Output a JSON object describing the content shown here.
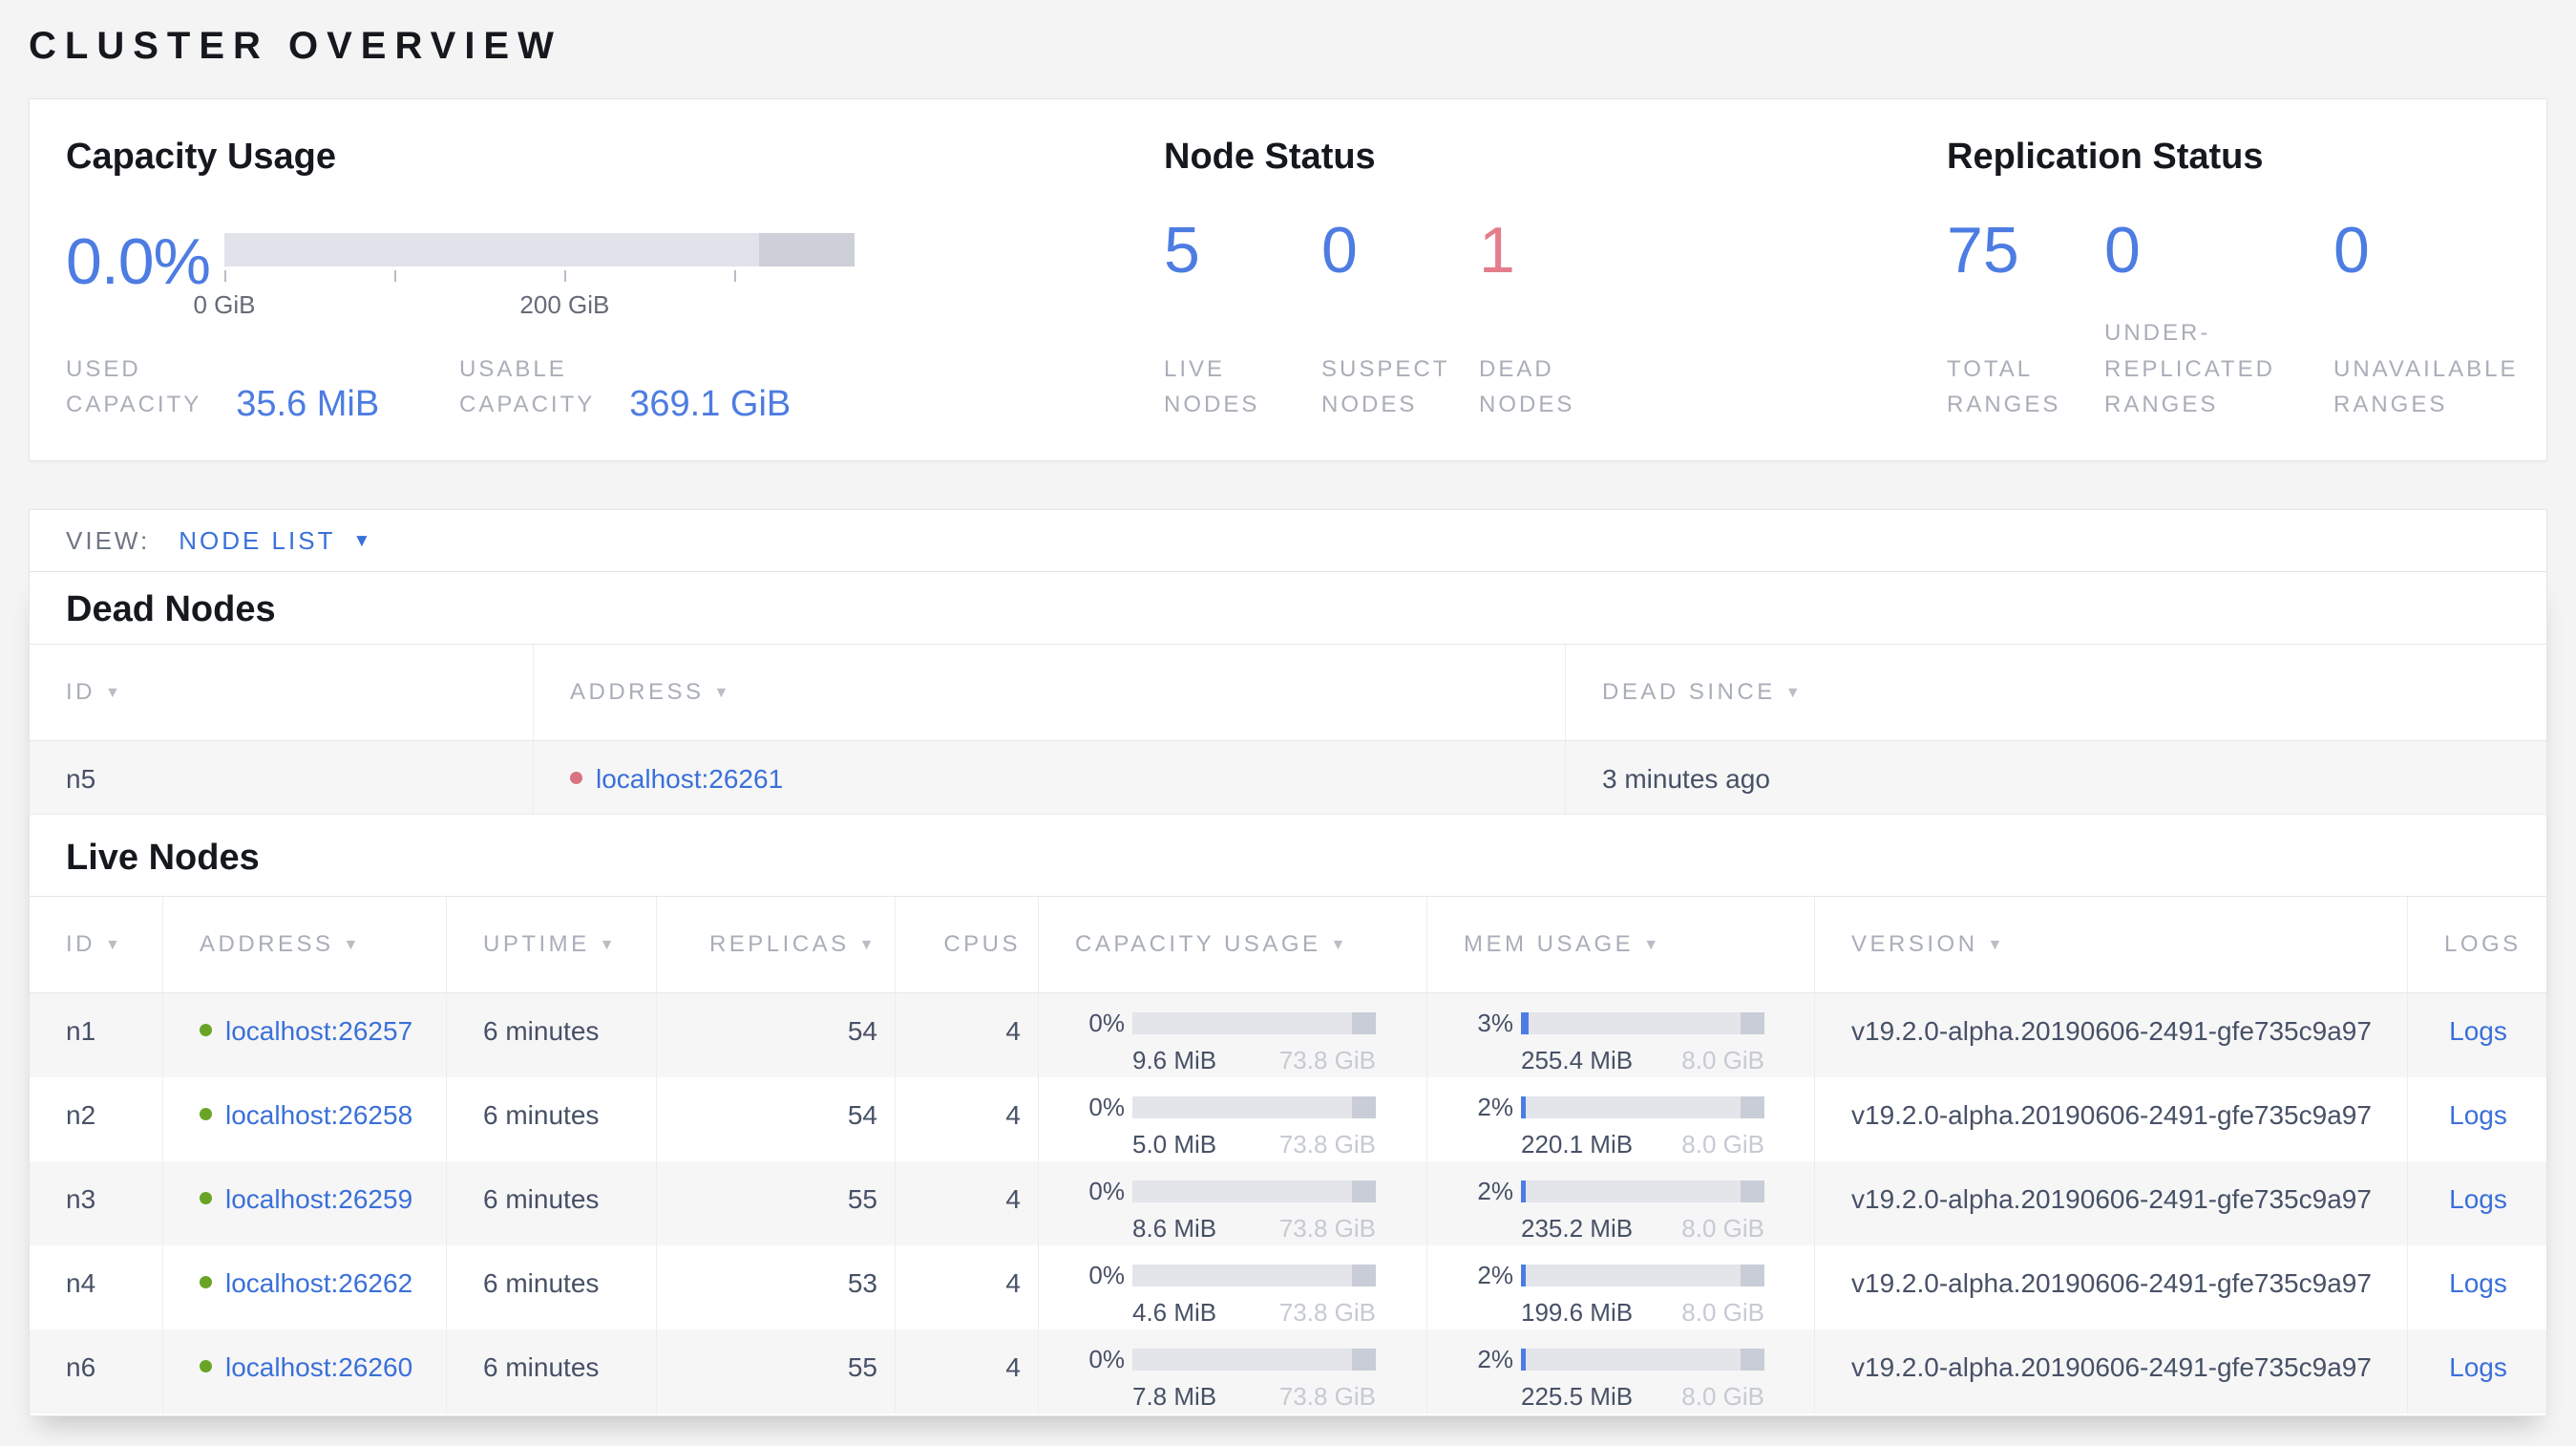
{
  "page": {
    "title": "CLUSTER OVERVIEW"
  },
  "colors": {
    "accent-blue": "#4d7ce2",
    "link-blue": "#3a70d9",
    "danger-red": "#e37d8c",
    "live-green": "#69a426",
    "dead-red": "#d9737f"
  },
  "icons": {
    "sort_desc": "▼",
    "dropdown_caret": "▼"
  },
  "summary": {
    "capacity": {
      "title": "Capacity Usage",
      "percent": "0.0%",
      "bar": {
        "tail_width": "15.2%",
        "ticks": [
          {
            "left": "0%"
          },
          {
            "left": "27%"
          },
          {
            "left": "54%"
          },
          {
            "left": "80.9%"
          }
        ],
        "tick_labels": [
          {
            "text": "0 GiB",
            "left": "0%"
          },
          {
            "text": "200 GiB",
            "left": "54%"
          }
        ]
      },
      "used_label": "USED\nCAPACITY",
      "used_value": "35.6 MiB",
      "usable_label": "USABLE\nCAPACITY",
      "usable_value": "369.1 GiB"
    },
    "node_status": {
      "title": "Node Status",
      "stats": [
        {
          "value": "5",
          "label": "LIVE\nNODES"
        },
        {
          "value": "0",
          "label": "SUSPECT\nNODES"
        },
        {
          "value": "1",
          "label": "DEAD\nNODES"
        }
      ]
    },
    "replication": {
      "title": "Replication Status",
      "stats": [
        {
          "value": "75",
          "label": "TOTAL\nRANGES"
        },
        {
          "value": "0",
          "label": "UNDER-\nREPLICATED\nRANGES"
        },
        {
          "value": "0",
          "label": "UNAVAILABLE\nRANGES"
        }
      ]
    }
  },
  "view_bar": {
    "label": "VIEW:",
    "selected": "NODE LIST"
  },
  "dead_nodes": {
    "heading": "Dead Nodes",
    "columns": {
      "id": "ID",
      "address": "ADDRESS",
      "dead_since": "DEAD SINCE"
    },
    "rows": [
      {
        "id": "n5",
        "address": "localhost:26261",
        "dead_since": "3 minutes ago"
      }
    ]
  },
  "live_nodes": {
    "heading": "Live Nodes",
    "columns": {
      "id": "ID",
      "address": "ADDRESS",
      "uptime": "UPTIME",
      "replicas": "REPLICAS",
      "cpus": "CPUS",
      "capacity": "CAPACITY USAGE",
      "mem": "MEM USAGE",
      "version": "VERSION",
      "logs": "LOGS"
    },
    "rows": [
      {
        "id": "n1",
        "address": "localhost:26257",
        "uptime": "6 minutes",
        "replicas": "54",
        "cpus": "4",
        "cap_pct": "0%",
        "cap_used": "9.6 MiB",
        "cap_total": "73.8 GiB",
        "mem_pct": "3%",
        "mem_used": "255.4 MiB",
        "mem_total": "8.0 GiB",
        "version": "v19.2.0-alpha.20190606-2491-gfe735c9a97",
        "logs": "Logs"
      },
      {
        "id": "n2",
        "address": "localhost:26258",
        "uptime": "6 minutes",
        "replicas": "54",
        "cpus": "4",
        "cap_pct": "0%",
        "cap_used": "5.0 MiB",
        "cap_total": "73.8 GiB",
        "mem_pct": "2%",
        "mem_used": "220.1 MiB",
        "mem_total": "8.0 GiB",
        "version": "v19.2.0-alpha.20190606-2491-gfe735c9a97",
        "logs": "Logs"
      },
      {
        "id": "n3",
        "address": "localhost:26259",
        "uptime": "6 minutes",
        "replicas": "55",
        "cpus": "4",
        "cap_pct": "0%",
        "cap_used": "8.6 MiB",
        "cap_total": "73.8 GiB",
        "mem_pct": "2%",
        "mem_used": "235.2 MiB",
        "mem_total": "8.0 GiB",
        "version": "v19.2.0-alpha.20190606-2491-gfe735c9a97",
        "logs": "Logs"
      },
      {
        "id": "n4",
        "address": "localhost:26262",
        "uptime": "6 minutes",
        "replicas": "53",
        "cpus": "4",
        "cap_pct": "0%",
        "cap_used": "4.6 MiB",
        "cap_total": "73.8 GiB",
        "mem_pct": "2%",
        "mem_used": "199.6 MiB",
        "mem_total": "8.0 GiB",
        "version": "v19.2.0-alpha.20190606-2491-gfe735c9a97",
        "logs": "Logs"
      },
      {
        "id": "n6",
        "address": "localhost:26260",
        "uptime": "6 minutes",
        "replicas": "55",
        "cpus": "4",
        "cap_pct": "0%",
        "cap_used": "7.8 MiB",
        "cap_total": "73.8 GiB",
        "mem_pct": "2%",
        "mem_used": "225.5 MiB",
        "mem_total": "8.0 GiB",
        "version": "v19.2.0-alpha.20190606-2491-gfe735c9a97",
        "logs": "Logs"
      }
    ]
  }
}
